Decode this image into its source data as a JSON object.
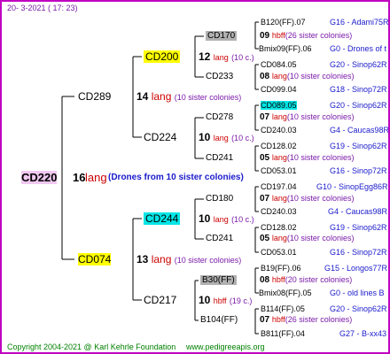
{
  "header": {
    "date": "20-  3-2021 ( 17: 23)"
  },
  "root": {
    "name": "CD220",
    "number": "16",
    "breed": "lang",
    "note": "(Drones from 10 sister colonies)"
  },
  "gen1": [
    {
      "name": "CD289",
      "number": "14",
      "breed": "lang",
      "note": "(10 sister colonies)"
    },
    {
      "name": "CD074",
      "number": "13",
      "breed": "lang",
      "note": "(10 sister colonies)"
    }
  ],
  "gen2": [
    {
      "name": "CD200",
      "number": "12",
      "breed": "lang",
      "note": "(10 c.)"
    },
    {
      "name": "CD224",
      "number": "10",
      "breed": "lang",
      "note": "(10 c.)"
    },
    {
      "name": "CD244",
      "number": "10",
      "breed": "lang",
      "note": "(10 c.)"
    },
    {
      "name": "CD217",
      "number": "10",
      "breed": "hbff",
      "note": "(19 c.)"
    }
  ],
  "gen3": [
    {
      "name": "CD170",
      "number": "09",
      "breed": "hbff",
      "note": "(26 sister colonies)"
    },
    {
      "name": "CD233",
      "number": "08",
      "breed": "lang",
      "note": "(10 sister colonies)"
    },
    {
      "name": "CD278",
      "number": "07",
      "breed": "lang",
      "note": "(10 sister colonies)"
    },
    {
      "name": "CD241",
      "number": "05",
      "breed": "lang",
      "note": "(10 sister colonies)"
    },
    {
      "name": "CD180",
      "number": "07",
      "breed": "lang",
      "note": "(10 sister colonies)"
    },
    {
      "name": "CD241",
      "number": "05",
      "breed": "lang",
      "note": "(10 sister colonies)"
    },
    {
      "name": "B30(FF)",
      "number": "08",
      "breed": "hbff",
      "note": "(20 sister colonies)"
    },
    {
      "name": "B104(FF)",
      "number": "07",
      "breed": "hbff",
      "note": "(26 sister colonies)"
    }
  ],
  "gen4": [
    {
      "name": "B120(FF).07",
      "origin": "G16 - Adami75R"
    },
    {
      "name": "Bmix09(FF).06",
      "origin": "G0 - Drones of t"
    },
    {
      "name": "CD084.05",
      "origin": "G20 - Sinop62R"
    },
    {
      "name": "CD099.04",
      "origin": "G18 - Sinop72R"
    },
    {
      "name": "CD089.05",
      "origin": "G20 - Sinop62R"
    },
    {
      "name": "CD240.03",
      "origin": "G4 - Caucas98R"
    },
    {
      "name": "CD128.02",
      "origin": "G19 - Sinop62R"
    },
    {
      "name": "CD053.01",
      "origin": "G16 - Sinop72R"
    },
    {
      "name": "CD197.04",
      "origin": "G10 - SinopEgg86R"
    },
    {
      "name": "CD240.03",
      "origin": "G4 - Caucas98R"
    },
    {
      "name": "CD128.02",
      "origin": "G19 - Sinop62R"
    },
    {
      "name": "CD053.01",
      "origin": "G16 - Sinop72R"
    },
    {
      "name": "B19(FF).06",
      "origin": "G15 - Longos77R"
    },
    {
      "name": "Bmix08(FF).05",
      "origin": "G0 - old lines B"
    },
    {
      "name": "B114(FF).05",
      "origin": "G20 - Sinop62R"
    },
    {
      "name": "B811(FF).04",
      "origin": "G27 - B-xx43"
    }
  ],
  "footer": {
    "copyright": "Copyright 2004-2021 @ Karl Kehrle Foundation",
    "website": "www.pedigreeapis.org"
  }
}
